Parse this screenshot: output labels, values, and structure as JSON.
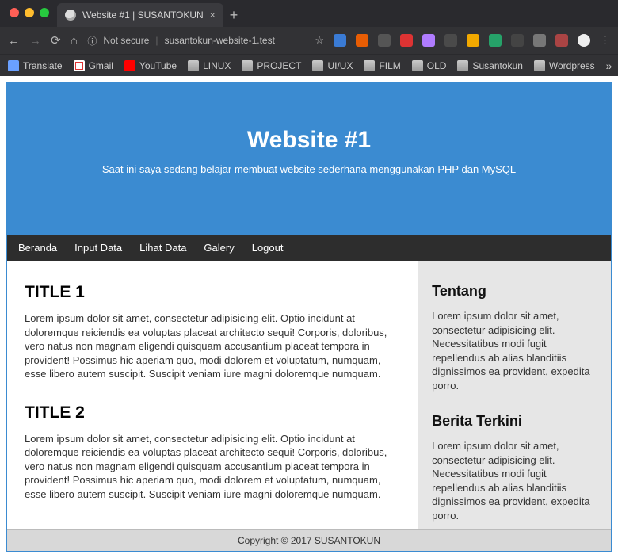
{
  "browser": {
    "tab_title": "Website #1 | SUSANTOKUN",
    "url_notsecure": "Not secure",
    "url": "susantokun-website-1.test",
    "bookmarks": [
      "Translate",
      "Gmail",
      "YouTube",
      "LINUX",
      "PROJECT",
      "UI/UX",
      "FILM",
      "OLD",
      "Susantokun",
      "Wordpress"
    ]
  },
  "hero": {
    "title": "Website #1",
    "subtitle": "Saat ini saya sedang belajar membuat website sederhana menggunakan PHP dan MySQL"
  },
  "nav": [
    "Beranda",
    "Input Data",
    "Lihat Data",
    "Galery",
    "Logout"
  ],
  "articles": [
    {
      "title": "TITLE 1",
      "body": "Lorem ipsum dolor sit amet, consectetur adipisicing elit. Optio incidunt at doloremque reiciendis ea voluptas placeat architecto sequi! Corporis, doloribus, vero natus non magnam eligendi quisquam accusantium placeat tempora in provident! Possimus hic aperiam quo, modi dolorem et voluptatum, numquam, esse libero autem suscipit. Suscipit veniam iure magni doloremque numquam."
    },
    {
      "title": "TITLE 2",
      "body": "Lorem ipsum dolor sit amet, consectetur adipisicing elit. Optio incidunt at doloremque reiciendis ea voluptas placeat architecto sequi! Corporis, doloribus, vero natus non magnam eligendi quisquam accusantium placeat tempora in provident! Possimus hic aperiam quo, modi dolorem et voluptatum, numquam, esse libero autem suscipit. Suscipit veniam iure magni doloremque numquam."
    }
  ],
  "sidebar": [
    {
      "title": "Tentang",
      "body": "Lorem ipsum dolor sit amet, consectetur adipisicing elit. Necessitatibus modi fugit repellendus ab alias blanditiis dignissimos ea provident, expedita porro."
    },
    {
      "title": "Berita Terkini",
      "body": "Lorem ipsum dolor sit amet, consectetur adipisicing elit. Necessitatibus modi fugit repellendus ab alias blanditiis dignissimos ea provident, expedita porro."
    }
  ],
  "footer": "Copyright © 2017 SUSANTOKUN"
}
